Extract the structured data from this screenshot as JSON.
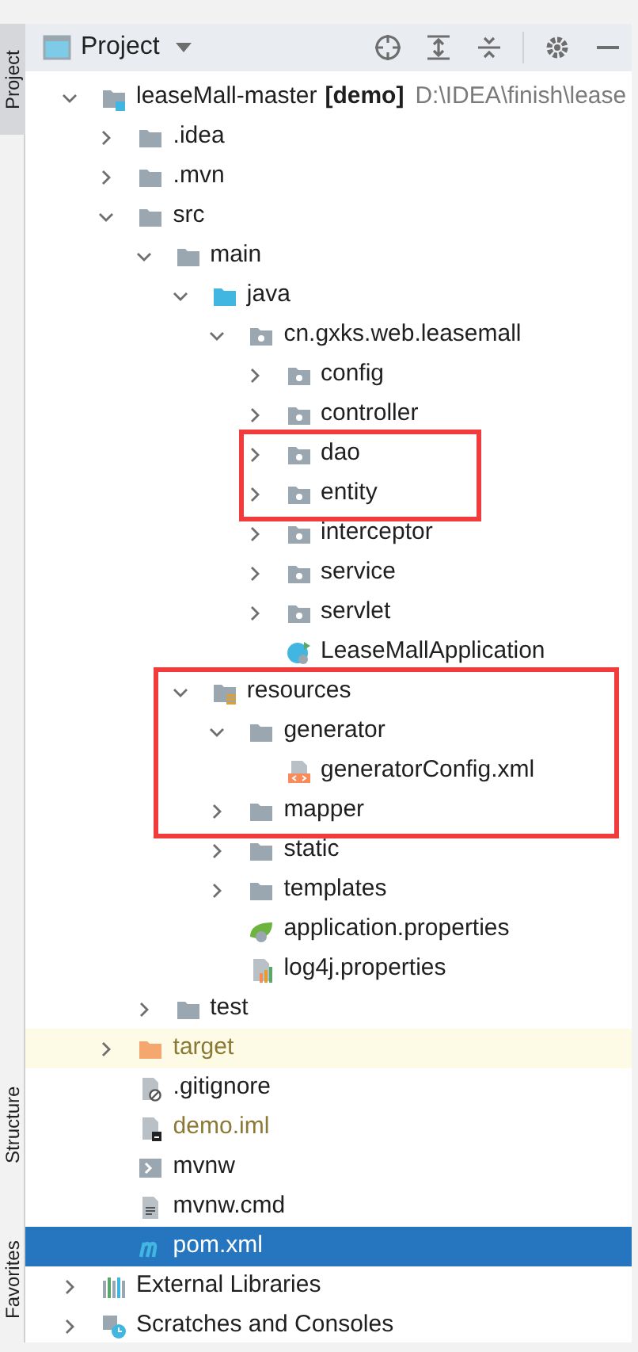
{
  "tool_strip": [
    {
      "label": "Project",
      "selected": true
    },
    {
      "label": "Structure",
      "selected": false
    },
    {
      "label": "Favorites",
      "selected": false
    }
  ],
  "panel": {
    "title": "Project"
  },
  "tree": [
    {
      "kind": "module",
      "name": "leaseMall-master",
      "tag": "[demo]",
      "path": "D:\\IDEA\\finish\\lease",
      "expanded": true,
      "selected": false,
      "ignored": false,
      "highlighted": false,
      "children": [
        {
          "kind": "folder",
          "name": ".idea",
          "expanded": false,
          "selected": false,
          "ignored": false,
          "highlighted": false
        },
        {
          "kind": "folder",
          "name": ".mvn",
          "expanded": false,
          "selected": false,
          "ignored": false,
          "highlighted": false
        },
        {
          "kind": "folder",
          "name": "src",
          "expanded": true,
          "selected": false,
          "ignored": false,
          "highlighted": false,
          "children": [
            {
              "kind": "folder",
              "name": "main",
              "expanded": true,
              "selected": false,
              "ignored": false,
              "highlighted": false,
              "children": [
                {
                  "kind": "source",
                  "name": "java",
                  "expanded": true,
                  "selected": false,
                  "ignored": false,
                  "highlighted": false,
                  "children": [
                    {
                      "kind": "package",
                      "name": "cn.gxks.web.leasemall",
                      "expanded": true,
                      "selected": false,
                      "ignored": false,
                      "highlighted": false,
                      "children": [
                        {
                          "kind": "package",
                          "name": "config",
                          "expanded": false,
                          "selected": false,
                          "ignored": false,
                          "highlighted": false
                        },
                        {
                          "kind": "package",
                          "name": "controller",
                          "expanded": false,
                          "selected": false,
                          "ignored": false,
                          "highlighted": false
                        },
                        {
                          "kind": "package",
                          "name": "dao",
                          "expanded": false,
                          "selected": false,
                          "ignored": false,
                          "highlighted": true
                        },
                        {
                          "kind": "package",
                          "name": "entity",
                          "expanded": false,
                          "selected": false,
                          "ignored": false,
                          "highlighted": true
                        },
                        {
                          "kind": "package",
                          "name": "interceptor",
                          "expanded": false,
                          "selected": false,
                          "ignored": false,
                          "highlighted": false
                        },
                        {
                          "kind": "package",
                          "name": "service",
                          "expanded": false,
                          "selected": false,
                          "ignored": false,
                          "highlighted": false
                        },
                        {
                          "kind": "package",
                          "name": "servlet",
                          "expanded": false,
                          "selected": false,
                          "ignored": false,
                          "highlighted": false
                        },
                        {
                          "kind": "app",
                          "name": "LeaseMallApplication",
                          "selected": false,
                          "ignored": false,
                          "highlighted": false
                        }
                      ]
                    }
                  ]
                },
                {
                  "kind": "resources",
                  "name": "resources",
                  "expanded": true,
                  "selected": false,
                  "ignored": false,
                  "highlighted": true,
                  "children": [
                    {
                      "kind": "folder",
                      "name": "generator",
                      "expanded": true,
                      "selected": false,
                      "ignored": false,
                      "highlighted": true,
                      "children": [
                        {
                          "kind": "xml",
                          "name": "generatorConfig.xml",
                          "selected": false,
                          "ignored": false,
                          "highlighted": true
                        }
                      ]
                    },
                    {
                      "kind": "folder",
                      "name": "mapper",
                      "expanded": false,
                      "selected": false,
                      "ignored": false,
                      "highlighted": true
                    },
                    {
                      "kind": "folder",
                      "name": "static",
                      "expanded": false,
                      "selected": false,
                      "ignored": false,
                      "highlighted": false
                    },
                    {
                      "kind": "folder",
                      "name": "templates",
                      "expanded": false,
                      "selected": false,
                      "ignored": false,
                      "highlighted": false
                    },
                    {
                      "kind": "spring",
                      "name": "application.properties",
                      "selected": false,
                      "ignored": false,
                      "highlighted": false
                    },
                    {
                      "kind": "properties",
                      "name": "log4j.properties",
                      "selected": false,
                      "ignored": false,
                      "highlighted": false
                    }
                  ]
                }
              ]
            },
            {
              "kind": "folder",
              "name": "test",
              "expanded": false,
              "selected": false,
              "ignored": false,
              "highlighted": false
            }
          ]
        },
        {
          "kind": "excluded",
          "name": "target",
          "expanded": false,
          "selected": false,
          "ignored": true,
          "highlighted": false
        },
        {
          "kind": "gitignore",
          "name": ".gitignore",
          "selected": false,
          "ignored": false,
          "highlighted": false
        },
        {
          "kind": "iml",
          "name": "demo.iml",
          "selected": false,
          "ignored": true,
          "highlighted": false
        },
        {
          "kind": "script",
          "name": "mvnw",
          "selected": false,
          "ignored": false,
          "highlighted": false
        },
        {
          "kind": "text",
          "name": "mvnw.cmd",
          "selected": false,
          "ignored": false,
          "highlighted": false
        },
        {
          "kind": "maven",
          "name": "pom.xml",
          "selected": true,
          "ignored": false,
          "highlighted": false
        }
      ]
    },
    {
      "kind": "libraries",
      "name": "External Libraries",
      "expanded": false,
      "selected": false,
      "ignored": false,
      "highlighted": false
    },
    {
      "kind": "scratches",
      "name": "Scratches and Consoles",
      "expanded": false,
      "selected": false,
      "ignored": false,
      "highlighted": false
    }
  ]
}
